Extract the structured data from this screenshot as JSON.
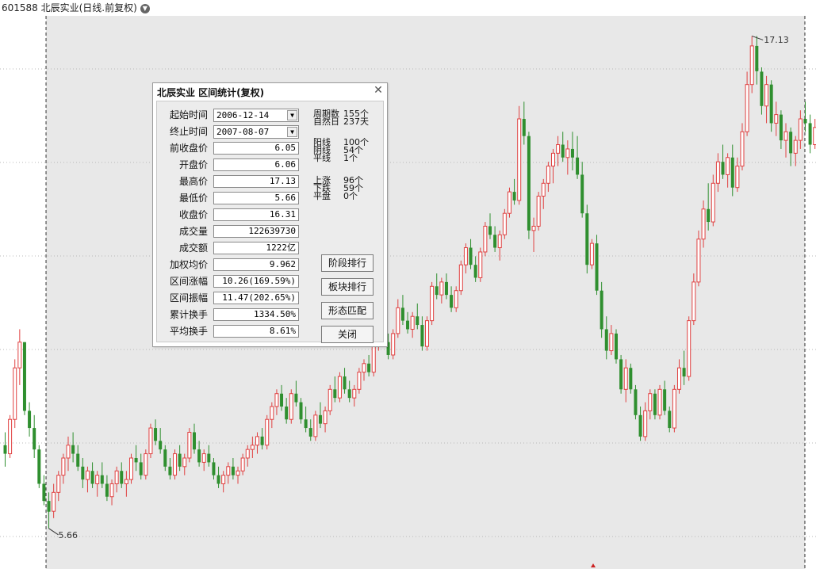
{
  "header": {
    "title": "601588 北辰实业(日线.前复权)",
    "menu_icon": "chevron-down-icon"
  },
  "colors": {
    "up": "#e04040",
    "down": "#2f8f2f",
    "selection": "#e8e8e8",
    "grid": "#b8b8b8"
  },
  "chart_data": {
    "type": "candlestick",
    "max_label": "17.13",
    "min_label": "5.66",
    "ylim": [
      4.9,
      17.6
    ],
    "candles": [
      [
        7.6,
        7.9,
        7.1,
        7.4
      ],
      [
        7.4,
        8.3,
        7.3,
        8.2
      ],
      [
        8.2,
        9.6,
        8.0,
        9.4
      ],
      [
        9.4,
        10.3,
        9.0,
        10.0
      ],
      [
        10.0,
        10.0,
        8.3,
        8.4
      ],
      [
        8.4,
        8.6,
        7.8,
        8.0
      ],
      [
        8.0,
        8.3,
        7.3,
        7.5
      ],
      [
        7.5,
        7.6,
        6.6,
        6.7
      ],
      [
        6.7,
        6.9,
        6.2,
        6.3
      ],
      [
        6.3,
        6.5,
        5.66,
        6.05
      ],
      [
        6.06,
        6.7,
        5.9,
        6.5
      ],
      [
        6.5,
        7.0,
        6.3,
        6.9
      ],
      [
        6.9,
        7.4,
        6.7,
        7.3
      ],
      [
        7.3,
        7.8,
        7.0,
        7.6
      ],
      [
        7.6,
        7.9,
        7.2,
        7.4
      ],
      [
        7.4,
        7.6,
        7.0,
        7.1
      ],
      [
        7.1,
        7.3,
        6.6,
        6.8
      ],
      [
        6.8,
        7.1,
        6.5,
        7.0
      ],
      [
        7.0,
        7.2,
        6.6,
        6.7
      ],
      [
        6.7,
        7.0,
        6.4,
        6.9
      ],
      [
        6.9,
        7.2,
        6.6,
        6.7
      ],
      [
        6.7,
        6.9,
        6.3,
        6.4
      ],
      [
        6.4,
        6.8,
        6.2,
        6.7
      ],
      [
        6.7,
        7.1,
        6.5,
        7.0
      ],
      [
        7.0,
        7.2,
        6.6,
        6.7
      ],
      [
        6.7,
        7.0,
        6.4,
        6.8
      ],
      [
        6.8,
        7.4,
        6.7,
        7.3
      ],
      [
        7.3,
        7.6,
        7.0,
        7.2
      ],
      [
        7.2,
        7.4,
        6.8,
        6.9
      ],
      [
        6.9,
        7.5,
        6.8,
        7.4
      ],
      [
        7.4,
        8.1,
        7.3,
        8.0
      ],
      [
        8.0,
        8.2,
        7.6,
        7.7
      ],
      [
        7.7,
        8.0,
        7.4,
        7.5
      ],
      [
        7.5,
        7.6,
        7.0,
        7.1
      ],
      [
        7.1,
        7.3,
        6.8,
        6.9
      ],
      [
        6.9,
        7.5,
        6.8,
        7.4
      ],
      [
        7.4,
        7.6,
        7.0,
        7.1
      ],
      [
        7.1,
        7.4,
        6.9,
        7.3
      ],
      [
        7.3,
        8.0,
        7.2,
        7.9
      ],
      [
        7.9,
        8.1,
        7.4,
        7.5
      ],
      [
        7.5,
        7.7,
        7.1,
        7.2
      ],
      [
        7.2,
        7.5,
        7.0,
        7.4
      ],
      [
        7.4,
        7.6,
        7.1,
        7.2
      ],
      [
        7.2,
        7.3,
        6.8,
        6.9
      ],
      [
        6.9,
        7.1,
        6.6,
        6.7
      ],
      [
        6.7,
        7.0,
        6.5,
        6.9
      ],
      [
        6.9,
        7.2,
        6.7,
        7.1
      ],
      [
        7.1,
        7.3,
        6.8,
        6.9
      ],
      [
        6.9,
        7.1,
        6.7,
        7.0
      ],
      [
        7.0,
        7.4,
        6.9,
        7.3
      ],
      [
        7.3,
        7.6,
        7.1,
        7.5
      ],
      [
        7.5,
        7.8,
        7.3,
        7.6
      ],
      [
        7.6,
        7.9,
        7.4,
        7.8
      ],
      [
        7.8,
        8.0,
        7.5,
        7.6
      ],
      [
        7.6,
        8.3,
        7.5,
        8.2
      ],
      [
        8.2,
        8.6,
        8.0,
        8.5
      ],
      [
        8.5,
        8.9,
        8.3,
        8.8
      ],
      [
        8.8,
        9.0,
        8.4,
        8.5
      ],
      [
        8.5,
        8.7,
        8.1,
        8.2
      ],
      [
        8.2,
        8.9,
        8.1,
        8.8
      ],
      [
        8.8,
        9.1,
        8.5,
        8.6
      ],
      [
        8.6,
        8.7,
        8.1,
        8.2
      ],
      [
        8.2,
        8.5,
        7.9,
        8.0
      ],
      [
        8.0,
        8.2,
        7.7,
        7.8
      ],
      [
        7.8,
        8.4,
        7.7,
        8.3
      ],
      [
        8.3,
        8.6,
        8.0,
        8.1
      ],
      [
        8.1,
        8.5,
        7.9,
        8.4
      ],
      [
        8.4,
        9.0,
        8.3,
        8.9
      ],
      [
        8.9,
        9.2,
        8.6,
        8.7
      ],
      [
        8.7,
        9.3,
        8.6,
        9.2
      ],
      [
        9.2,
        9.4,
        8.8,
        8.9
      ],
      [
        8.9,
        9.1,
        8.6,
        8.7
      ],
      [
        8.7,
        9.0,
        8.5,
        8.9
      ],
      [
        8.9,
        9.4,
        8.8,
        9.3
      ],
      [
        9.3,
        9.6,
        9.1,
        9.5
      ],
      [
        9.5,
        9.7,
        9.2,
        9.3
      ],
      [
        9.3,
        10.1,
        9.2,
        10.0
      ],
      [
        10.0,
        10.4,
        9.8,
        10.3
      ],
      [
        10.3,
        10.6,
        9.9,
        10.0
      ],
      [
        10.0,
        10.2,
        9.6,
        9.7
      ],
      [
        9.7,
        10.3,
        9.6,
        10.2
      ],
      [
        10.2,
        11.0,
        10.1,
        10.8
      ],
      [
        10.8,
        11.1,
        10.4,
        10.5
      ],
      [
        10.5,
        10.7,
        10.2,
        10.3
      ],
      [
        10.3,
        10.7,
        10.1,
        10.6
      ],
      [
        10.6,
        10.9,
        10.3,
        10.4
      ],
      [
        10.4,
        10.6,
        9.8,
        9.9
      ],
      [
        9.9,
        10.6,
        9.8,
        10.5
      ],
      [
        10.5,
        11.4,
        10.4,
        11.3
      ],
      [
        11.3,
        11.6,
        11.0,
        11.1
      ],
      [
        11.1,
        11.5,
        10.9,
        11.4
      ],
      [
        11.4,
        11.6,
        11.0,
        11.1
      ],
      [
        11.1,
        11.3,
        10.7,
        10.8
      ],
      [
        10.8,
        11.3,
        10.7,
        11.2
      ],
      [
        11.2,
        11.9,
        11.1,
        11.8
      ],
      [
        11.8,
        12.3,
        11.6,
        12.2
      ],
      [
        12.2,
        12.4,
        11.7,
        11.8
      ],
      [
        11.8,
        12.0,
        11.4,
        11.5
      ],
      [
        11.5,
        12.2,
        11.4,
        12.1
      ],
      [
        12.1,
        12.8,
        12.0,
        12.7
      ],
      [
        12.7,
        13.0,
        12.4,
        12.5
      ],
      [
        12.5,
        12.7,
        12.1,
        12.2
      ],
      [
        12.2,
        12.6,
        11.9,
        12.5
      ],
      [
        12.5,
        13.1,
        12.4,
        13.0
      ],
      [
        13.0,
        13.6,
        12.9,
        13.5
      ],
      [
        13.5,
        13.8,
        13.2,
        13.3
      ],
      [
        13.3,
        15.5,
        13.2,
        15.2
      ],
      [
        15.2,
        15.6,
        14.6,
        14.8
      ],
      [
        14.8,
        14.9,
        12.4,
        12.6
      ],
      [
        12.6,
        12.9,
        12.1,
        12.7
      ],
      [
        12.7,
        13.5,
        12.6,
        13.4
      ],
      [
        13.4,
        13.8,
        13.1,
        13.7
      ],
      [
        13.7,
        14.2,
        13.5,
        14.1
      ],
      [
        14.1,
        14.5,
        13.7,
        14.4
      ],
      [
        14.4,
        14.8,
        14.1,
        14.6
      ],
      [
        14.6,
        14.9,
        14.2,
        14.3
      ],
      [
        14.3,
        14.7,
        13.9,
        14.5
      ],
      [
        14.5,
        14.9,
        14.0,
        14.3
      ],
      [
        14.3,
        14.8,
        13.8,
        13.9
      ],
      [
        13.9,
        14.2,
        12.9,
        13.0
      ],
      [
        13.0,
        13.2,
        11.6,
        11.8
      ],
      [
        11.8,
        12.4,
        11.7,
        12.3
      ],
      [
        12.3,
        12.5,
        11.1,
        11.2
      ],
      [
        11.2,
        11.4,
        10.1,
        10.3
      ],
      [
        10.3,
        10.6,
        9.6,
        9.8
      ],
      [
        9.8,
        10.4,
        9.7,
        10.2
      ],
      [
        10.2,
        10.3,
        9.5,
        9.6
      ],
      [
        9.6,
        9.7,
        8.8,
        8.9
      ],
      [
        8.9,
        9.6,
        8.6,
        9.4
      ],
      [
        9.4,
        9.5,
        8.8,
        8.9
      ],
      [
        8.9,
        9.0,
        8.2,
        8.3
      ],
      [
        8.3,
        8.5,
        7.7,
        7.8
      ],
      [
        7.8,
        8.6,
        7.7,
        8.4
      ],
      [
        8.4,
        8.9,
        8.2,
        8.8
      ],
      [
        8.8,
        8.9,
        8.2,
        8.3
      ],
      [
        8.3,
        9.0,
        8.2,
        8.9
      ],
      [
        8.9,
        9.1,
        8.3,
        8.4
      ],
      [
        8.4,
        8.5,
        7.9,
        8.0
      ],
      [
        8.0,
        9.0,
        7.9,
        8.9
      ],
      [
        8.9,
        9.6,
        8.8,
        9.4
      ],
      [
        9.4,
        9.8,
        9.0,
        9.2
      ],
      [
        9.2,
        10.6,
        9.1,
        10.5
      ],
      [
        10.5,
        11.6,
        10.4,
        11.4
      ],
      [
        11.4,
        12.6,
        11.3,
        12.4
      ],
      [
        12.4,
        13.3,
        12.2,
        13.1
      ],
      [
        13.1,
        13.7,
        12.6,
        12.8
      ],
      [
        12.8,
        13.9,
        12.7,
        13.7
      ],
      [
        13.7,
        14.4,
        13.5,
        14.2
      ],
      [
        14.2,
        14.6,
        13.8,
        13.9
      ],
      [
        13.9,
        14.4,
        13.6,
        14.3
      ],
      [
        14.3,
        14.6,
        13.4,
        13.6
      ],
      [
        13.6,
        14.3,
        13.5,
        14.1
      ],
      [
        14.1,
        15.1,
        14.0,
        14.9
      ],
      [
        14.9,
        16.3,
        14.8,
        16.0
      ],
      [
        16.0,
        17.13,
        15.8,
        16.9
      ],
      [
        16.9,
        17.13,
        16.0,
        16.31
      ],
      [
        16.3,
        16.4,
        15.3,
        15.5
      ],
      [
        15.5,
        16.2,
        15.1,
        16.0
      ],
      [
        16.0,
        16.1,
        14.9,
        15.1
      ],
      [
        15.1,
        15.6,
        14.8,
        15.3
      ],
      [
        15.3,
        15.4,
        14.5,
        14.7
      ],
      [
        14.7,
        15.1,
        14.3,
        14.9
      ],
      [
        14.9,
        15.0,
        14.1,
        14.4
      ],
      [
        14.4,
        14.8,
        14.1,
        14.7
      ],
      [
        14.7,
        15.4,
        14.5,
        15.2
      ],
      [
        15.2,
        15.6,
        14.9,
        15.1
      ],
      [
        15.1,
        15.3,
        14.4,
        14.6
      ],
      [
        14.6,
        15.2,
        14.5,
        15.0
      ],
      [
        15.0,
        15.4,
        14.6,
        14.7
      ],
      [
        14.7,
        15.0,
        14.2,
        14.4
      ],
      [
        14.4,
        15.3,
        14.3,
        15.1
      ]
    ],
    "selection": {
      "from_index": 9,
      "to_index": 165
    }
  },
  "dialog": {
    "title": "北辰实业 区间统计(复权)",
    "close_icon": "close-icon",
    "fields": [
      {
        "label": "起始时间",
        "value": "2006-12-14",
        "dropdown": true
      },
      {
        "label": "终止时间",
        "value": "2007-08-07",
        "dropdown": true
      },
      {
        "label": "前收盘价",
        "value": "6.05"
      },
      {
        "label": "开盘价",
        "value": "6.06"
      },
      {
        "label": "最高价",
        "value": "17.13"
      },
      {
        "label": "最低价",
        "value": "5.66"
      },
      {
        "label": "收盘价",
        "value": "16.31"
      },
      {
        "label": "成交量",
        "value": "122639730"
      },
      {
        "label": "成交额",
        "value": "1222亿"
      },
      {
        "label": "加权均价",
        "value": "9.962"
      },
      {
        "label": "区间涨幅",
        "value": "10.26(169.59%)"
      },
      {
        "label": "区间振幅",
        "value": "11.47(202.65%)"
      },
      {
        "label": "累计换手",
        "value": "1334.50%"
      },
      {
        "label": "平均换手",
        "value": "8.61%"
      }
    ],
    "stats": [
      {
        "label": "周期数",
        "value": "155个"
      },
      {
        "label": "自然日",
        "value": "237天"
      },
      {
        "label": "阳线",
        "value": "100个"
      },
      {
        "label": "阴线",
        "value": "54个"
      },
      {
        "label": "平线",
        "value": "1个"
      },
      {
        "label": "上涨",
        "value": "96个"
      },
      {
        "label": "下跌",
        "value": "59个"
      },
      {
        "label": "平盘",
        "value": "0个"
      }
    ],
    "buttons": [
      {
        "name": "stage-ranking-button",
        "label": "阶段排行"
      },
      {
        "name": "sector-ranking-button",
        "label": "板块排行"
      },
      {
        "name": "pattern-match-button",
        "label": "形态匹配"
      },
      {
        "name": "close-button",
        "label": "关闭"
      }
    ]
  }
}
